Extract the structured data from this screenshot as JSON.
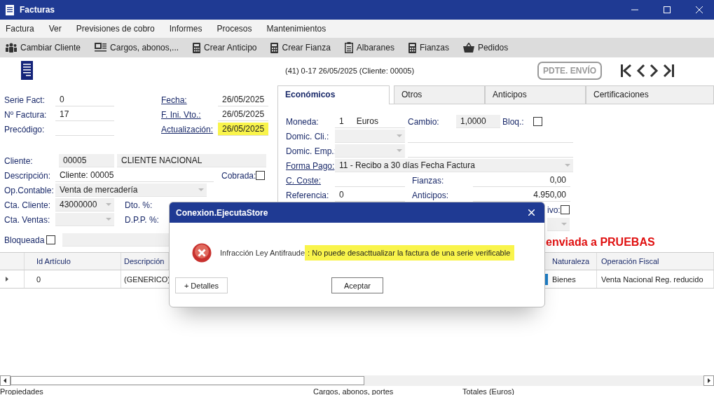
{
  "window": {
    "title": "Facturas"
  },
  "menu": [
    "Factura",
    "Ver",
    "Previsiones de cobro",
    "Informes",
    "Procesos",
    "Mantenimientos"
  ],
  "toolbar": [
    {
      "label": "Cambiar Cliente",
      "kind": "people"
    },
    {
      "label": "Cargos, abonos,...",
      "kind": "card"
    },
    {
      "label": "Crear Anticipo",
      "kind": "calculator"
    },
    {
      "label": "Crear Fianza",
      "kind": "calculator"
    },
    {
      "label": "Albaranes",
      "kind": "clipboard"
    },
    {
      "label": "Fianzas",
      "kind": "calculator"
    },
    {
      "label": "Pedidos",
      "kind": "basket"
    }
  ],
  "header": {
    "record_info": "(41) 0-17  26/05/2025  (Cliente: 00005)",
    "status_badge": "PDTE. ENVÍO"
  },
  "invoice": [
    {
      "label": "Serie Fact:",
      "value": "0",
      "date_label": "Fecha:",
      "date": "26/05/2025",
      "highlighted": false
    },
    {
      "label": "Nº Factura:",
      "value": "17",
      "date_label": "F. Ini. Vto.:",
      "date": "26/05/2025",
      "highlighted": false
    },
    {
      "label": "Precódigo:",
      "date_label": "Actualización:",
      "date": "26/05/2025",
      "highlighted": true
    }
  ],
  "client": {
    "label": "Cliente:",
    "code": "00005",
    "name": "CLIENTE NACIONAL"
  },
  "description": {
    "label": "Descripción:",
    "value": "Cliente: 00005",
    "paid_label": "Cobrada:",
    "paid": false
  },
  "accounting": {
    "label": "Op.Contable:",
    "value": "Venta de mercadería"
  },
  "client_account": {
    "label": "Cta. Cliente:",
    "value": "43000000",
    "discount_label": "Dto. %:"
  },
  "sales_account": {
    "label": "Cta. Ventas:",
    "ppd_label": "D.P.P. %:"
  },
  "blocked": {
    "label": "Bloqueada",
    "checked": false
  },
  "tabs": [
    {
      "label": "Económicos",
      "selected": true
    },
    {
      "label": "Otros",
      "selected": false
    },
    {
      "label": "Anticipos",
      "selected": false
    },
    {
      "label": "Certificaciones",
      "selected": false
    }
  ],
  "economic": {
    "currency_label": "Moneda:",
    "currency_code": "1",
    "currency_name": "Euros",
    "rate_label": "Cambio:",
    "rate": "1,0000",
    "lock_label": "Bloq.:",
    "locked": false,
    "client_address_label": "Domic. Cli.:",
    "company_address_label": "Domic. Emp.:",
    "payment_label": "Forma Pago:",
    "payment": "11 - Recibo a 30 días Fecha Factura",
    "cost_center_label": "C. Coste:",
    "deposits_label": "Fianzas:",
    "deposits": "0,00",
    "reference_label": "Referencia:",
    "reference": "0",
    "advances_label": "Anticipos:",
    "advances": "4.950,00",
    "cut_label": "ivo:",
    "cut_checked": false
  },
  "notice": "enviada a PRUEBAS",
  "grid": {
    "columns": [
      "Id Artículo",
      "Descripción",
      "Naturaleza",
      "Operación Fiscal"
    ],
    "rows": [
      {
        "cells": [
          "0",
          "(GENERICO)",
          "Bienes",
          "Venta Nacional Reg. reducido"
        ],
        "color": "#1e7fc8"
      }
    ]
  },
  "dialog": {
    "title": "Conexion.EjecutaStore",
    "message_label": "Infracción Ley Antifraude",
    "message": ": No puede desacttualizar la factura de una serie verificable",
    "buttons": [
      "+ Detalles",
      "Aceptar"
    ]
  },
  "status_bar": [
    "Propiedades",
    "Cargos, abonos, portes",
    "Totales (Euros)"
  ]
}
